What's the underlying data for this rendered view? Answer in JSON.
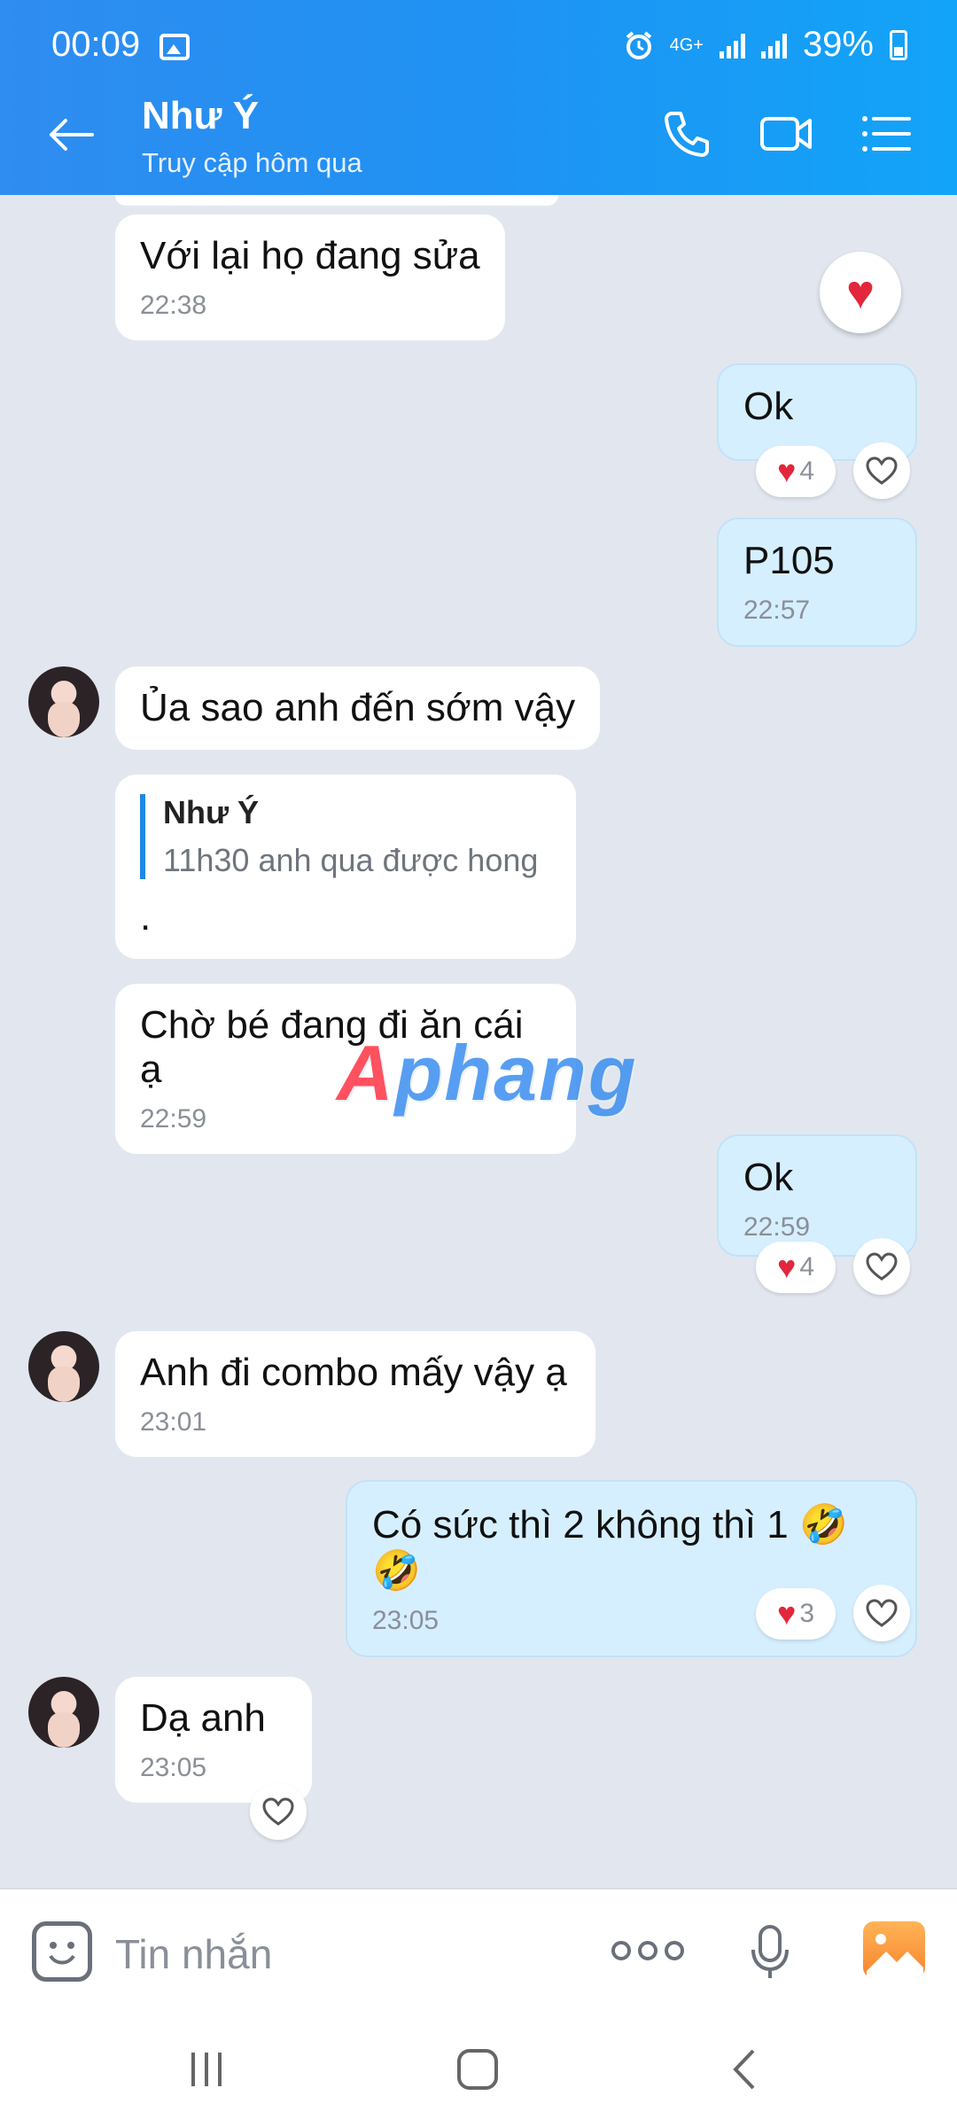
{
  "status_bar": {
    "time": "00:09",
    "network": "4G+",
    "battery": "39%"
  },
  "header": {
    "name": "Như Ý",
    "subtitle": "Truy cập hôm qua"
  },
  "messages": [
    {
      "text": "Với lại họ đang sửa",
      "time": "22:38"
    },
    {
      "text": "Ok",
      "reaction_count": "4"
    },
    {
      "text": "P105",
      "time": "22:57"
    },
    {
      "text": "Ủa sao anh đến sớm vậy"
    },
    {
      "quote_name": "Như Ý",
      "quote_text": "11h30 anh qua được hong",
      "text": "."
    },
    {
      "text": "Chờ bé đang đi ăn cái ạ",
      "time": "22:59"
    },
    {
      "text": "Ok",
      "time": "22:59",
      "reaction_count": "4"
    },
    {
      "text": "Anh đi combo mấy vậy ạ",
      "time": "23:01"
    },
    {
      "text": "Có sức thì 2 không thì 1 🤣🤣",
      "time": "23:05",
      "reaction_count": "3"
    },
    {
      "text": "Dạ anh",
      "time": "23:05"
    }
  ],
  "watermark": {
    "a": "A",
    "rest": "phang"
  },
  "composer": {
    "placeholder": "Tin nhắn"
  },
  "colors": {
    "header": "#1f92f3",
    "outgoing": "#d6efff",
    "background": "#e2e7ef",
    "heart": "#e2263b"
  }
}
